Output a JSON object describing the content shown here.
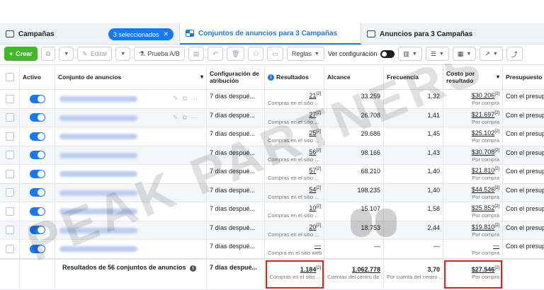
{
  "tabs": [
    {
      "label": "Campañas",
      "badge": "3 seleccionados",
      "badge_close": "✕"
    },
    {
      "label": "Conjuntos de anuncios para 3 Campañas"
    },
    {
      "label": "Anuncios para 3 Campañas"
    }
  ],
  "toolbar": {
    "create": "Crear",
    "edit": "Editar",
    "ab_test": "Prueba A/B",
    "rules": "Reglas",
    "view_config": "Ver configuración"
  },
  "columns": {
    "active": "Activo",
    "name": "Conjunto de anuncios",
    "attribution": "Configuración de atribución",
    "results": "Resultados",
    "reach": "Alcance",
    "frequency": "Frecuencia",
    "cost": "Costo por resultado",
    "budget": "Presupuesto"
  },
  "rows": [
    {
      "attr": "7 días despué...",
      "results": "21",
      "results_sup": "[2]",
      "results_sub": "Compras en el sitio ...",
      "reach": "33.259",
      "freq": "1,32",
      "cost": "$30.206",
      "cost_sup": "[2]",
      "cost_sub": "Por compra",
      "budget": "Con el presup"
    },
    {
      "attr": "7 días despué...",
      "results": "27",
      "results_sup": "[2]",
      "results_sub": "Compras en el sitio ...",
      "reach": "26.708",
      "freq": "1,41",
      "cost": "$21.697",
      "cost_sup": "[2]",
      "cost_sub": "Por compra",
      "budget": "Con el presup"
    },
    {
      "attr": "7 días despué...",
      "results": "25",
      "results_sup": "[2]",
      "results_sub": "Compras en el sitio ...",
      "reach": "29.686",
      "freq": "1,45",
      "cost": "$25.102",
      "cost_sup": "[2]",
      "cost_sub": "Por compra",
      "budget": "Con el presup"
    },
    {
      "attr": "7 días despué...",
      "results": "56",
      "results_sup": "[2]",
      "results_sub": "Compras en el sitio ...",
      "reach": "98.166",
      "freq": "1,43",
      "cost": "$30.708",
      "cost_sup": "[2]",
      "cost_sub": "Por compra",
      "budget": "Con el presup"
    },
    {
      "attr": "7 días despué...",
      "results": "57",
      "results_sup": "[2]",
      "results_sub": "Compras en el sitio ...",
      "reach": "68.210",
      "freq": "1,40",
      "cost": "$21.810",
      "cost_sup": "[2]",
      "cost_sub": "Por compra",
      "budget": "Con el presup"
    },
    {
      "attr": "7 días despué...",
      "results": "54",
      "results_sup": "[2]",
      "results_sub": "Compras en el sitio ...",
      "reach": "198.235",
      "freq": "1,40",
      "cost": "$44.526",
      "cost_sup": "[2]",
      "cost_sub": "Por compra",
      "budget": "Con el presup"
    },
    {
      "attr": "7 días despué...",
      "results": "10",
      "results_sup": "[2]",
      "results_sub": "Compras en el sitio ...",
      "reach": "15.107",
      "freq": "1,58",
      "cost": "$25.852",
      "cost_sup": "[2]",
      "cost_sub": "Por compra",
      "budget": "Con el presup"
    },
    {
      "attr": "7 días despué...",
      "results": "20",
      "results_sup": "[2]",
      "results_sub": "Compras en el sitio ...",
      "reach": "18.753",
      "freq": "2,44",
      "cost": "$19.810",
      "cost_sup": "[2]",
      "cost_sub": "Por compra",
      "budget": "Con el presup"
    },
    {
      "attr": "7 días despué...",
      "results": "—",
      "results_sup": "",
      "results_sub": "Compra en el sitio web",
      "reach": "—",
      "freq": "—",
      "cost": "—",
      "cost_sup": "",
      "cost_sub": "Por compra",
      "budget": "Con el presup"
    }
  ],
  "total": {
    "label": "Resultados de 56 conjuntos de anuncios",
    "attr": "7 días despué...",
    "results": "1.184",
    "results_sup": "[2]",
    "results_sub": "Compras en el sitio ...",
    "reach": "1.062.778",
    "reach_sub": "Cuentas del centro de ...",
    "freq": "3,70",
    "freq_sub": "Por cuenta del centro ...",
    "cost": "$27.546",
    "cost_sup": "[2]",
    "cost_sub": "Por compra"
  },
  "watermark": {
    "text": "PEAK PARTNERS"
  },
  "colors": {
    "accent": "#1877f2",
    "create": "#42b72a",
    "highlight": "#e0201a"
  }
}
